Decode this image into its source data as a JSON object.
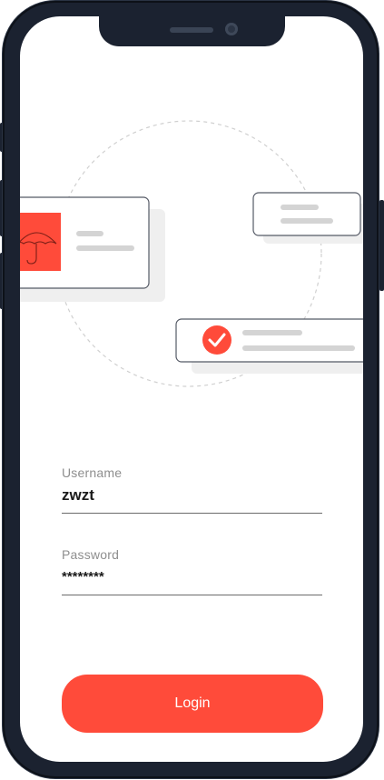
{
  "form": {
    "username": {
      "label": "Username",
      "value": "zwzt"
    },
    "password": {
      "label": "Password",
      "value": "********"
    }
  },
  "login_button": {
    "label": "Login"
  },
  "colors": {
    "accent": "#ff4b3a",
    "frame": "#1b2230",
    "check_icon_bg": "#ff4b3a"
  },
  "icons": {
    "umbrella": "umbrella-icon",
    "check": "check-circle-icon"
  }
}
